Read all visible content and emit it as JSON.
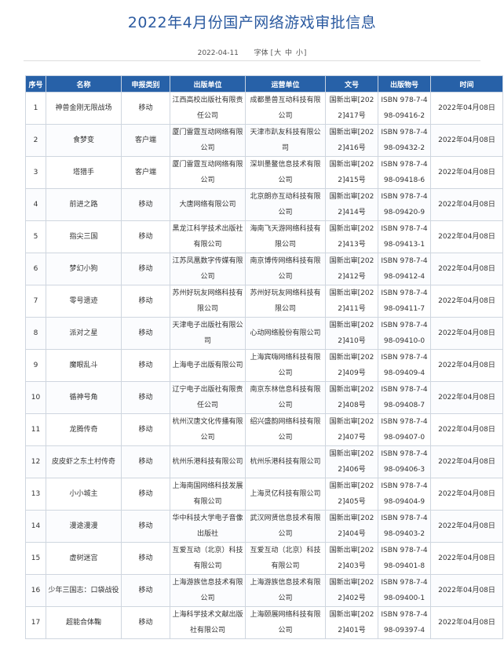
{
  "title": "2022年4月份国产网络游戏审批信息",
  "meta": {
    "date": "2022-04-11",
    "font_label": "字体",
    "bracket_open": "[",
    "bracket_close": "]",
    "size_large": "大",
    "size_medium": "中",
    "size_small": "小"
  },
  "table": {
    "headers": [
      "序号",
      "名称",
      "申报类别",
      "出版单位",
      "运营单位",
      "文号",
      "出版物号",
      "时间"
    ],
    "rows": [
      {
        "no": "1",
        "name": "神兽金刚无限战场",
        "category": "移动",
        "publisher": "江西高校出版社有限责任公司",
        "operator": "成都墨兽互动科技有限公司",
        "doc": "国新出审[2022]417号",
        "isbn": "ISBN 978-7-498-09416-2",
        "date": "2022年04月08日"
      },
      {
        "no": "2",
        "name": "食梦变",
        "category": "客户端",
        "publisher": "厦门雷霆互动网络有限公司",
        "operator": "天津市趴友科技有限公司",
        "doc": "国新出审[2022]416号",
        "isbn": "ISBN 978-7-498-09432-2",
        "date": "2022年04月08日"
      },
      {
        "no": "3",
        "name": "塔猎手",
        "category": "客户端",
        "publisher": "厦门雷霆互动网络有限公司",
        "operator": "深圳墨鳌信息技术有限公司",
        "doc": "国新出审[2022]415号",
        "isbn": "ISBN 978-7-498-09418-6",
        "date": "2022年04月08日"
      },
      {
        "no": "4",
        "name": "前进之路",
        "category": "移动",
        "publisher": "大唐网络有限公司",
        "operator": "北京朗亦互动科技有限公司",
        "doc": "国新出审[2022]414号",
        "isbn": "ISBN 978-7-498-09420-9",
        "date": "2022年04月08日"
      },
      {
        "no": "5",
        "name": "指尖三国",
        "category": "移动",
        "publisher": "黑龙江科学技术出版社有限公司",
        "operator": "海南飞天游网络科技有限公司",
        "doc": "国新出审[2022]413号",
        "isbn": "ISBN 978-7-498-09413-1",
        "date": "2022年04月08日"
      },
      {
        "no": "6",
        "name": "梦幻小狗",
        "category": "移动",
        "publisher": "江苏凤凰数字传媒有限公司",
        "operator": "南京博传网络科技有限公司",
        "doc": "国新出审[2022]412号",
        "isbn": "ISBN 978-7-498-09412-4",
        "date": "2022年04月08日"
      },
      {
        "no": "7",
        "name": "零号遗迹",
        "category": "移动",
        "publisher": "苏州好玩友网络科技有限公司",
        "operator": "苏州好玩友网络科技有限公司",
        "doc": "国新出审[2022]411号",
        "isbn": "ISBN 978-7-498-09411-7",
        "date": "2022年04月08日"
      },
      {
        "no": "8",
        "name": "派对之星",
        "category": "移动",
        "publisher": "天津电子出版社有限公司",
        "operator": "心动网络股份有限公司",
        "doc": "国新出审[2022]410号",
        "isbn": "ISBN 978-7-498-09410-0",
        "date": "2022年04月08日"
      },
      {
        "no": "9",
        "name": "魔眼乱斗",
        "category": "移动",
        "publisher": "上海电子出版有限公司",
        "operator": "上海宾嗨网络科技有限公司",
        "doc": "国新出审[2022]409号",
        "isbn": "ISBN 978-7-498-09409-4",
        "date": "2022年04月08日"
      },
      {
        "no": "10",
        "name": "循神号角",
        "category": "移动",
        "publisher": "辽宁电子出版社有限责任公司",
        "operator": "南京东林信息科技有限公司",
        "doc": "国新出审[2022]408号",
        "isbn": "ISBN 978-7-498-09408-7",
        "date": "2022年04月08日"
      },
      {
        "no": "11",
        "name": "龙腾传奇",
        "category": "移动",
        "publisher": "杭州汉唐文化传播有限公司",
        "operator": "绍兴盛韵网络科技有限公司",
        "doc": "国新出审[2022]407号",
        "isbn": "ISBN 978-7-498-09407-0",
        "date": "2022年04月08日"
      },
      {
        "no": "12",
        "name": "皮皮虾之东土村传奇",
        "category": "移动",
        "publisher": "杭州乐港科技有限公司",
        "operator": "杭州乐港科技有限公司",
        "doc": "国新出审[2022]406号",
        "isbn": "ISBN 978-7-498-09406-3",
        "date": "2022年04月08日"
      },
      {
        "no": "13",
        "name": "小小城主",
        "category": "移动",
        "publisher": "上海南国网络科技发展有限公司",
        "operator": "上海灵亿科技有限公司",
        "doc": "国新出审[2022]405号",
        "isbn": "ISBN 978-7-498-09404-9",
        "date": "2022年04月08日"
      },
      {
        "no": "14",
        "name": "漫途漫漫",
        "category": "移动",
        "publisher": "华中科技大学电子音像出版社",
        "operator": "武汉网贤信息技术有限公司",
        "doc": "国新出审[2022]404号",
        "isbn": "ISBN 978-7-498-09403-2",
        "date": "2022年04月08日"
      },
      {
        "no": "15",
        "name": "虚树迷宫",
        "category": "移动",
        "publisher": "互爱互动（北京）科技有限公司",
        "operator": "互爱互动（北京）科技有限公司",
        "doc": "国新出审[2022]403号",
        "isbn": "ISBN 978-7-498-09401-8",
        "date": "2022年04月08日"
      },
      {
        "no": "16",
        "name": "少年三国志：口袋战役",
        "category": "移动",
        "publisher": "上海游族信息技术有限公司",
        "operator": "上海游族信息技术有限公司",
        "doc": "国新出审[2022]402号",
        "isbn": "ISBN 978-7-498-09400-1",
        "date": "2022年04月08日"
      },
      {
        "no": "17",
        "name": "超能合体鞠",
        "category": "移动",
        "publisher": "上海科学技术文献出版社有限公司",
        "operator": "上海颐展网络科技有限公司",
        "doc": "国新出审[2022]401号",
        "isbn": "ISBN 978-7-498-09397-4",
        "date": "2022年04月08日"
      }
    ]
  }
}
